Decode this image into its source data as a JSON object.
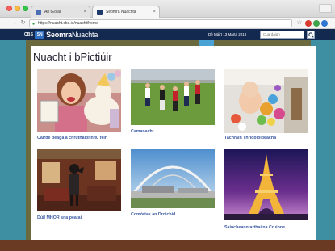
{
  "browser": {
    "tabs": [
      {
        "label": "An tEolaí"
      },
      {
        "label": "Seomra Nuachta"
      }
    ],
    "url": "https://nuacht.cbs.ie/nuacht/home"
  },
  "header": {
    "brand_small": "CBS",
    "brand_mark": "SN",
    "brand_bold": "Seomra",
    "brand_light": "Nuachta",
    "date": "Dé Máirt 13 Márta 2018",
    "search_placeholder": "Cuardaigh"
  },
  "main": {
    "title": "Nuacht i bPictiúir",
    "tiles": [
      {
        "caption": "Cairde beaga a chruthaíonn tú féin"
      },
      {
        "caption": "Camanacht"
      },
      {
        "caption": "Tachráin Thrioblóideacha"
      },
      {
        "caption": "Dúil MHÓR sna peataí"
      },
      {
        "caption": "Comórtas an Droichid"
      },
      {
        "caption": "Saincheanntarthaí na Cruinne"
      }
    ]
  },
  "colors": {
    "header_bg": "#13294f",
    "caption_link": "#3b5aa3",
    "page_teal": "#3f8fa3",
    "page_olive": "#6b6a3e"
  }
}
